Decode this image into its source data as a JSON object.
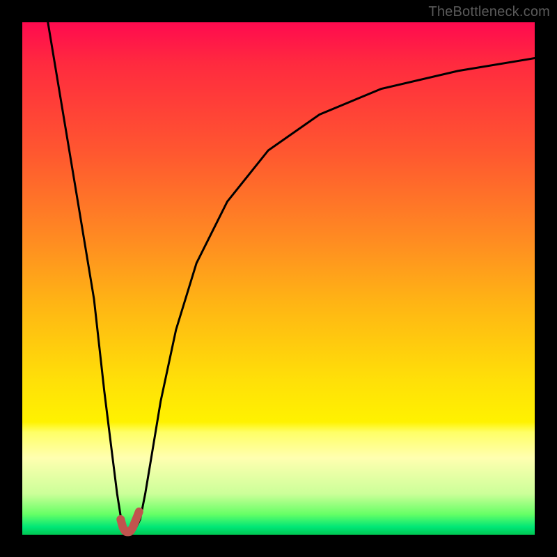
{
  "watermark": "TheBottleneck.com",
  "chart_data": {
    "type": "line",
    "title": "",
    "xlabel": "",
    "ylabel": "",
    "xlim": [
      0,
      100
    ],
    "ylim": [
      0,
      100
    ],
    "grid": false,
    "series": [
      {
        "name": "bottleneck-curve",
        "color": "#000000",
        "x": [
          5,
          8,
          11,
          14,
          16,
          17.5,
          18.5,
          19.3,
          20,
          21,
          22,
          23,
          24,
          25,
          27,
          30,
          34,
          40,
          48,
          58,
          70,
          85,
          100
        ],
        "values": [
          100,
          82,
          64,
          46,
          28,
          16,
          8,
          3,
          1,
          0.5,
          1,
          3,
          8,
          14,
          26,
          40,
          53,
          65,
          75,
          82,
          87,
          90.5,
          93
        ]
      },
      {
        "name": "highlight-dip",
        "color": "#c0544e",
        "x": [
          19.2,
          19.6,
          20.0,
          20.4,
          20.8,
          21.2,
          21.6,
          22.0,
          22.4,
          22.8
        ],
        "values": [
          3.0,
          1.5,
          0.8,
          0.5,
          0.5,
          0.8,
          1.5,
          2.5,
          3.5,
          4.5
        ]
      }
    ],
    "background_gradient": {
      "top": "#ff0a4f",
      "mid": "#ffe008",
      "bottom": "#00c853"
    }
  }
}
